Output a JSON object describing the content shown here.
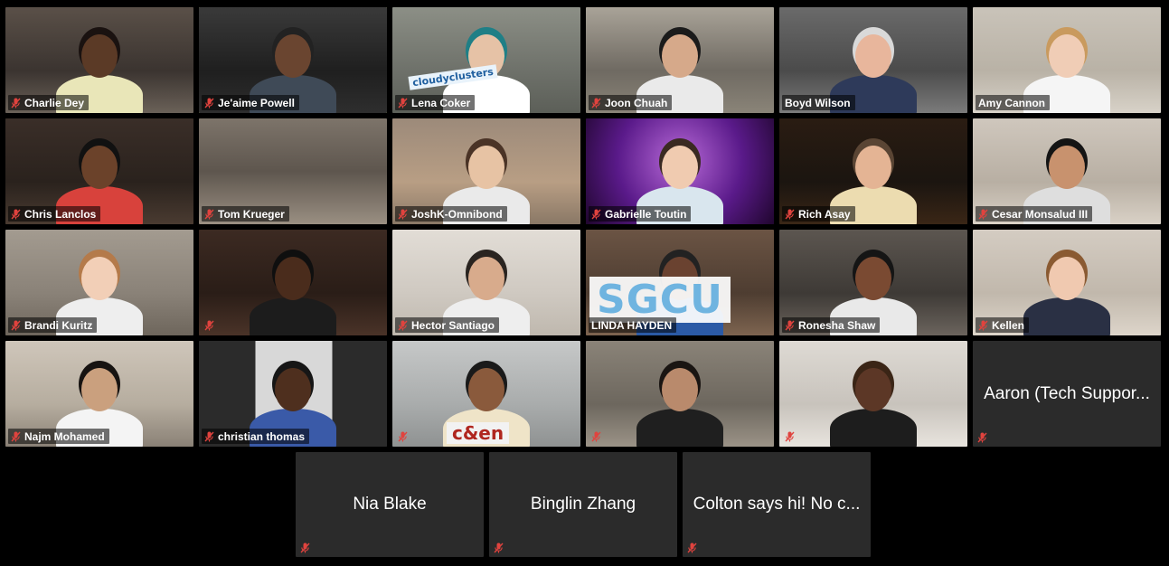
{
  "app": {
    "view": "Gallery View"
  },
  "colors": {
    "background": "#000000",
    "tile_background": "#2b2b2b",
    "active_speaker_border": "#d6f06a",
    "muted_icon": "#e0433e"
  },
  "participants": [
    {
      "name": "Charlie Dey",
      "muted": true
    },
    {
      "name": "Je'aime Powell",
      "muted": true,
      "active_speaker": true
    },
    {
      "name": "Lena Coker",
      "muted": true,
      "sign_text": "cloudyclusters"
    },
    {
      "name": "Joon Chuah",
      "muted": true
    },
    {
      "name": "Boyd Wilson",
      "muted": false
    },
    {
      "name": "Amy Cannon",
      "muted": false
    },
    {
      "name": "Chris Lanclos",
      "muted": true
    },
    {
      "name": "Tom Krueger",
      "muted": true
    },
    {
      "name": "JoshK-Omnibond",
      "muted": true
    },
    {
      "name": "Gabrielle Toutin",
      "muted": true
    },
    {
      "name": "Rich Asay",
      "muted": true
    },
    {
      "name": "Cesar Monsalud III",
      "muted": true
    },
    {
      "name": "Brandi Kuritz",
      "muted": true
    },
    {
      "name": "",
      "muted": true
    },
    {
      "name": "Hector Santiago",
      "muted": true
    },
    {
      "name": "LINDA HAYDEN",
      "muted": false,
      "sign_text": "SGCU"
    },
    {
      "name": "Ronesha Shaw",
      "muted": true
    },
    {
      "name": "Kellen",
      "muted": true
    },
    {
      "name": "Najm Mohamed",
      "muted": true
    },
    {
      "name": "christian thomas",
      "muted": true
    },
    {
      "name": "",
      "muted": true,
      "sign_text": "c&en"
    },
    {
      "name": "",
      "muted": true
    },
    {
      "name": "",
      "muted": true
    },
    {
      "name": "Aaron (Tech Suppor...",
      "muted": true,
      "video_off": true
    }
  ],
  "bottom_row": [
    {
      "name": "Nia Blake",
      "muted": true
    },
    {
      "name": "Binglin Zhang",
      "muted": true
    },
    {
      "name": "Colton says hi! No c...",
      "muted": true
    }
  ]
}
